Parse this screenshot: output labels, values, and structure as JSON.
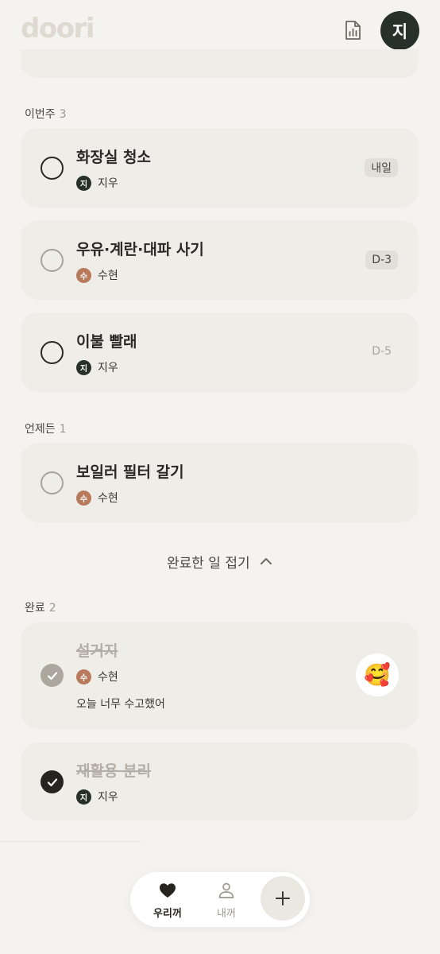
{
  "app": {
    "logo": "doori",
    "user_initial": "지"
  },
  "sections": {
    "this_week": {
      "label": "이번주",
      "count": "3"
    },
    "anytime": {
      "label": "언제든",
      "count": "1"
    },
    "done": {
      "label": "완료",
      "count": "2"
    }
  },
  "tasks": [
    {
      "title": "화장실 청소",
      "assignee": "지우",
      "assignee_initial": "지",
      "due": "내일"
    },
    {
      "title": "우유·계란·대파 사기",
      "assignee": "수현",
      "assignee_initial": "수",
      "due": "D-3"
    },
    {
      "title": "이불 빨래",
      "assignee": "지우",
      "assignee_initial": "지",
      "due": "D-5"
    },
    {
      "title": "보일러 필터 갈기",
      "assignee": "수현",
      "assignee_initial": "수",
      "due": ""
    }
  ],
  "collapse_label": "완료한 일 접기",
  "done_tasks": [
    {
      "title": "설거지",
      "assignee": "수현",
      "assignee_initial": "수",
      "comment": "오늘 너무 수고했어",
      "reaction": "🥰"
    },
    {
      "title": "재활용 분리",
      "assignee": "지우",
      "assignee_initial": "지"
    }
  ],
  "nav": {
    "us_label": "우리꺼",
    "mine_label": "내꺼",
    "add_icon": "plus-icon"
  },
  "colors": {
    "background": "#f5f3ef",
    "card": "#efede8",
    "dark": "#27302a",
    "suhyeon": "#b87a5b"
  }
}
